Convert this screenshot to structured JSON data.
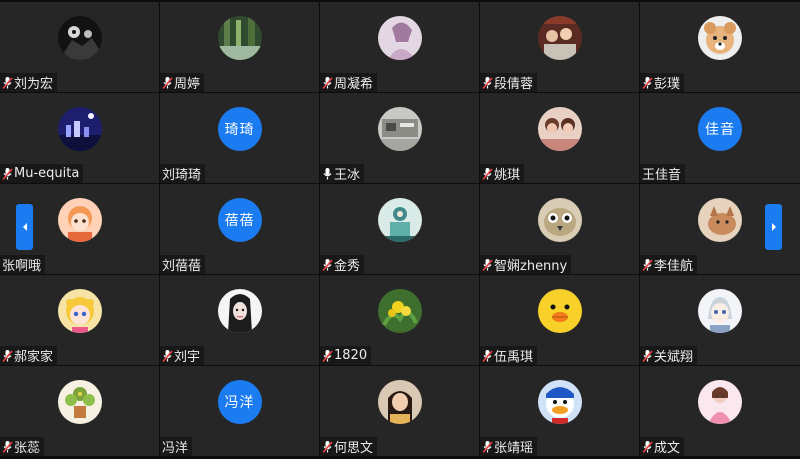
{
  "participants": [
    {
      "name": "刘为宏",
      "mic": "muted",
      "avatar": {
        "type": "image",
        "style": "dark-monster"
      }
    },
    {
      "name": "周婷",
      "mic": "muted",
      "avatar": {
        "type": "image",
        "style": "forest"
      }
    },
    {
      "name": "周凝希",
      "mic": "muted",
      "avatar": {
        "type": "image",
        "style": "pink-girl"
      }
    },
    {
      "name": "段倩蓉",
      "mic": "muted",
      "avatar": {
        "type": "image",
        "style": "group-photo"
      }
    },
    {
      "name": "彭璞",
      "mic": "muted",
      "avatar": {
        "type": "image",
        "style": "dog"
      }
    },
    {
      "name": "Mu-equita",
      "mic": "muted",
      "avatar": {
        "type": "image",
        "style": "night-city"
      }
    },
    {
      "name": "刘琦琦",
      "mic": "none",
      "avatar": {
        "type": "text",
        "text": "琦琦"
      }
    },
    {
      "name": "王冰",
      "mic": "on",
      "avatar": {
        "type": "image",
        "style": "gray-photo"
      }
    },
    {
      "name": "姚琪",
      "mic": "muted",
      "avatar": {
        "type": "image",
        "style": "girls"
      }
    },
    {
      "name": "王佳音",
      "mic": "none",
      "avatar": {
        "type": "text",
        "text": "佳音"
      }
    },
    {
      "name": "张啊哦",
      "mic": "none",
      "avatar": {
        "type": "image",
        "style": "anime-orange"
      }
    },
    {
      "name": "刘蓓蓓",
      "mic": "none",
      "avatar": {
        "type": "text",
        "text": "蓓蓓"
      }
    },
    {
      "name": "金秀",
      "mic": "muted",
      "avatar": {
        "type": "image",
        "style": "teal-art"
      }
    },
    {
      "name": "智娴zhenny",
      "mic": "muted",
      "avatar": {
        "type": "image",
        "style": "bird"
      }
    },
    {
      "name": "李佳航",
      "mic": "muted",
      "avatar": {
        "type": "image",
        "style": "cat"
      }
    },
    {
      "name": "郝家家",
      "mic": "muted",
      "avatar": {
        "type": "image",
        "style": "sailor-moon"
      }
    },
    {
      "name": "刘宇",
      "mic": "muted",
      "avatar": {
        "type": "image",
        "style": "sketch-girl"
      }
    },
    {
      "name": "1820",
      "mic": "muted",
      "avatar": {
        "type": "image",
        "style": "yellow-flower"
      }
    },
    {
      "name": "伍禹琪",
      "mic": "muted",
      "avatar": {
        "type": "image",
        "style": "chick"
      }
    },
    {
      "name": "关斌翔",
      "mic": "muted",
      "avatar": {
        "type": "image",
        "style": "anime-blue"
      }
    },
    {
      "name": "张蕊",
      "mic": "muted",
      "avatar": {
        "type": "image",
        "style": "plant"
      }
    },
    {
      "name": "冯洋",
      "mic": "none",
      "avatar": {
        "type": "text",
        "text": "冯洋"
      }
    },
    {
      "name": "何思文",
      "mic": "muted",
      "avatar": {
        "type": "image",
        "style": "selfie"
      }
    },
    {
      "name": "张靖瑶",
      "mic": "muted",
      "avatar": {
        "type": "image",
        "style": "duck"
      }
    },
    {
      "name": "成文",
      "mic": "muted",
      "avatar": {
        "type": "image",
        "style": "pink-illustration"
      }
    }
  ],
  "navigation": {
    "prev_icon": "chevron-left-icon",
    "next_icon": "chevron-right-icon"
  },
  "colors": {
    "tile": "#262626",
    "background": "#0d0d0d",
    "accent": "#1a7cf0",
    "mic_muted": "#e84040"
  }
}
